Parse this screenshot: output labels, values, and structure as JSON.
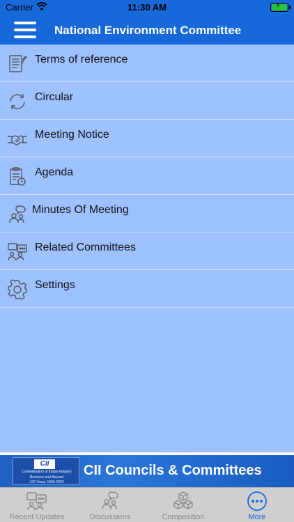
{
  "status_bar": {
    "carrier": "Carrier",
    "time": "11:30 AM",
    "battery_color": "#25c53b"
  },
  "nav": {
    "title": "National Environment Committee",
    "menu_icon": "hamburger-icon"
  },
  "menu": {
    "items": [
      {
        "label": "Terms of reference",
        "icon": "document-list-icon"
      },
      {
        "label": "Circular",
        "icon": "refresh-cycle-icon"
      },
      {
        "label": "Meeting Notice",
        "icon": "handshake-icon"
      },
      {
        "label": "Agenda",
        "icon": "clipboard-clock-icon"
      },
      {
        "label": "Minutes Of Meeting",
        "icon": "people-chat-icon"
      },
      {
        "label": "Related Committees",
        "icon": "people-presentation-icon"
      },
      {
        "label": "Settings",
        "icon": "gear-icon"
      }
    ]
  },
  "banner": {
    "logo_mark": "CII",
    "logo_line1": "Confederation of Indian Industry",
    "logo_line2": "Business and Beyond",
    "logo_line3": "125 Years: 1895-2020",
    "title": "CII Councils & Committees"
  },
  "tabs": [
    {
      "label": "Recent Updates",
      "icon": "chat-screen-icon",
      "active": false
    },
    {
      "label": "Discussions",
      "icon": "people-discussion-icon",
      "active": false
    },
    {
      "label": "Composition",
      "icon": "boxes-icon",
      "active": false
    },
    {
      "label": "More",
      "icon": "more-dots-icon",
      "active": true
    }
  ],
  "colors": {
    "primary": "#1768d8",
    "menu_background": "#9ec1ff",
    "tab_bar_background": "#cfcfcf",
    "tab_inactive": "#8a8a8a"
  }
}
